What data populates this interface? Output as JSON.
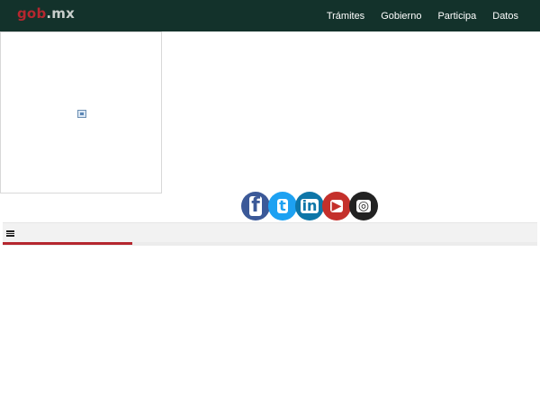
{
  "header": {
    "logo_gob": "gob",
    "logo_mx": ".mx",
    "nav": [
      "Trámites",
      "Gobierno",
      "Participa",
      "Datos"
    ]
  },
  "social": {
    "icons": [
      "facebook-icon",
      "twitter-icon",
      "linkedin-icon",
      "youtube-icon",
      "instagram-icon"
    ]
  },
  "colors": {
    "header_bg": "#13322b",
    "brand_red": "#b5272f",
    "menubar_bg": "#f2f2f2"
  }
}
